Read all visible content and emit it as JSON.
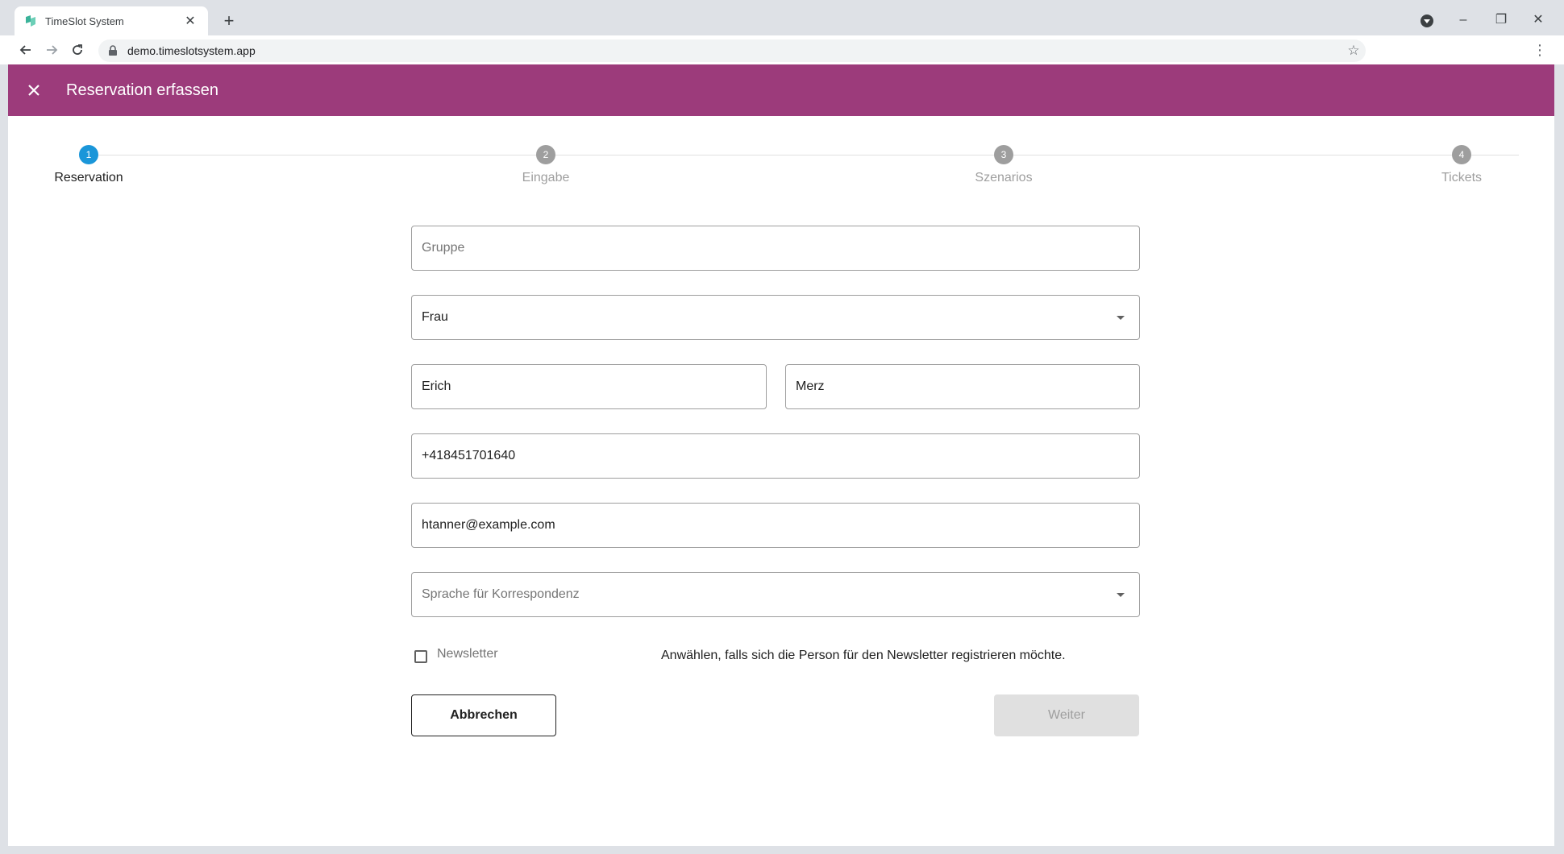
{
  "browser": {
    "tab_title": "TimeSlot System",
    "url": "demo.timeslotsystem.app",
    "tab_close": "✕",
    "new_tab": "+",
    "minimize": "–",
    "restore": "❐",
    "close": "✕",
    "menu": "⋮",
    "star": "☆"
  },
  "header": {
    "title": "Reservation erfassen",
    "color": "#9c3b7b"
  },
  "stepper": {
    "steps": [
      {
        "number": "1",
        "label": "Reservation"
      },
      {
        "number": "2",
        "label": "Eingabe"
      },
      {
        "number": "3",
        "label": "Szenarios"
      },
      {
        "number": "4",
        "label": "Tickets"
      }
    ],
    "active_step": 1,
    "active_color": "#1a96d9"
  },
  "form": {
    "group": {
      "placeholder": "Gruppe",
      "value": ""
    },
    "salutation": {
      "value": "Frau"
    },
    "first_name": {
      "value": "Erich"
    },
    "last_name": {
      "value": "Merz"
    },
    "phone": {
      "value": "+418451701640"
    },
    "email": {
      "value": "htanner@example.com"
    },
    "language": {
      "placeholder": "Sprache für Korrespondenz"
    },
    "newsletter": {
      "label": "Newsletter",
      "checked": false,
      "hint": "Anwählen, falls sich die Person für den Newsletter registrieren möchte."
    }
  },
  "buttons": {
    "cancel": "Abbrechen",
    "next": "Weiter"
  }
}
